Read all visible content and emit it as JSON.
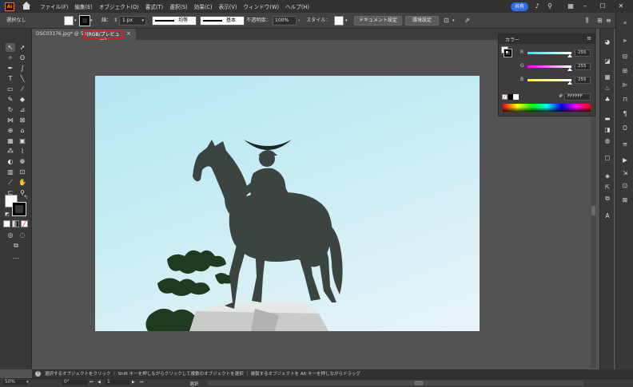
{
  "app": {
    "logo_text": "Ai",
    "menu": [
      "ファイル(F)",
      "編集(E)",
      "オブジェクト(O)",
      "書式(T)",
      "選択(S)",
      "効果(C)",
      "表示(V)",
      "ウィンドウ(W)",
      "ヘルプ(H)"
    ],
    "share_label": "共有"
  },
  "controlbar": {
    "selection_label": "選択なし",
    "stroke_label": "線：",
    "stroke_value": "1 px",
    "profile_label": "均等",
    "brush_label": "基本",
    "opacity_label": "不透明度：",
    "opacity_value": "100%",
    "style_label": "スタイル：",
    "document_setup": "ドキュメント設定",
    "preferences": "環境設定"
  },
  "document": {
    "tab_label": "DSC03176.jpg* @ 50",
    "mode_label": "(RGB/プレビュー)",
    "close_glyph": "×"
  },
  "color_panel": {
    "title": "カラー",
    "menu_glyph": "≡",
    "channels": [
      {
        "label": "R",
        "value": "255",
        "gradient": "linear-gradient(to right,#00ffff,#ffffff)"
      },
      {
        "label": "G",
        "value": "255",
        "gradient": "linear-gradient(to right,#ff00ff,#ffffff)"
      },
      {
        "label": "B",
        "value": "255",
        "gradient": "linear-gradient(to right,#ffff00,#ffffff)"
      }
    ],
    "hex_symbol": "#",
    "hex_value": "FFFFFF"
  },
  "status": {
    "hint": "選択するオブジェクトをクリック ｜ Shift キーを押しながらクリックして複数のオブジェクトを選択 ｜ 複製するオブジェクトを Alt キーを押しながらドラッグ",
    "zoom": "50%",
    "rotation": "0°",
    "artboard_num": "1",
    "tool_name": "選択"
  },
  "colors": {
    "accent": "#2d6ee8",
    "highlight_border": "#e01b24",
    "ui_bg": "#535353"
  }
}
